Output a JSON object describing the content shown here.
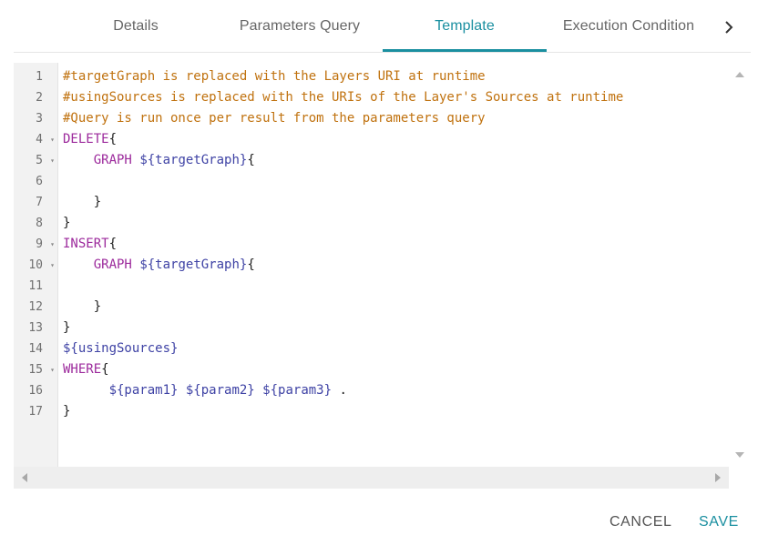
{
  "tabs": [
    {
      "label": "Details",
      "active": false
    },
    {
      "label": "Parameters Query",
      "active": false
    },
    {
      "label": "Template",
      "active": true
    },
    {
      "label": "Execution Condition",
      "active": false
    }
  ],
  "colors": {
    "accent": "#1a8fa0",
    "comment": "#c0720f",
    "keyword": "#9c2a9c",
    "variable": "#3f43a5"
  },
  "icons": {
    "tab_next": "chevron-right-icon",
    "fold": "fold-triangle-icon",
    "scroll_up": "arrow-up-icon",
    "scroll_down": "arrow-down-icon",
    "scroll_left": "arrow-left-icon",
    "scroll_right": "arrow-right-icon"
  },
  "editor": {
    "lines": [
      {
        "number": "1",
        "foldable": false,
        "tokens": [
          {
            "text": "#targetGraph is replaced with the Layers URI at runtime",
            "kind": "comment"
          }
        ]
      },
      {
        "number": "2",
        "foldable": false,
        "tokens": [
          {
            "text": "#usingSources is replaced with the URIs of the Layer's Sources at runtime",
            "kind": "comment"
          }
        ]
      },
      {
        "number": "3",
        "foldable": false,
        "tokens": [
          {
            "text": "#Query is run once per result from the parameters query",
            "kind": "comment"
          }
        ]
      },
      {
        "number": "4",
        "foldable": true,
        "tokens": [
          {
            "text": "DELETE",
            "kind": "kw"
          },
          {
            "text": "{",
            "kind": "plain"
          }
        ]
      },
      {
        "number": "5",
        "foldable": true,
        "tokens": [
          {
            "text": "    ",
            "kind": "plain"
          },
          {
            "text": "GRAPH",
            "kind": "kw"
          },
          {
            "text": " ",
            "kind": "plain"
          },
          {
            "text": "${targetGraph}",
            "kind": "var"
          },
          {
            "text": "{",
            "kind": "plain"
          }
        ]
      },
      {
        "number": "6",
        "foldable": false,
        "tokens": []
      },
      {
        "number": "7",
        "foldable": false,
        "tokens": [
          {
            "text": "    }",
            "kind": "plain"
          }
        ]
      },
      {
        "number": "8",
        "foldable": false,
        "tokens": [
          {
            "text": "}",
            "kind": "plain"
          }
        ]
      },
      {
        "number": "9",
        "foldable": true,
        "tokens": [
          {
            "text": "INSERT",
            "kind": "kw"
          },
          {
            "text": "{",
            "kind": "plain"
          }
        ]
      },
      {
        "number": "10",
        "foldable": true,
        "tokens": [
          {
            "text": "    ",
            "kind": "plain"
          },
          {
            "text": "GRAPH",
            "kind": "kw"
          },
          {
            "text": " ",
            "kind": "plain"
          },
          {
            "text": "${targetGraph}",
            "kind": "var"
          },
          {
            "text": "{",
            "kind": "plain"
          }
        ]
      },
      {
        "number": "11",
        "foldable": false,
        "tokens": []
      },
      {
        "number": "12",
        "foldable": false,
        "tokens": [
          {
            "text": "    }",
            "kind": "plain"
          }
        ]
      },
      {
        "number": "13",
        "foldable": false,
        "tokens": [
          {
            "text": "}",
            "kind": "plain"
          }
        ]
      },
      {
        "number": "14",
        "foldable": false,
        "tokens": [
          {
            "text": "${usingSources}",
            "kind": "var"
          }
        ]
      },
      {
        "number": "15",
        "foldable": true,
        "tokens": [
          {
            "text": "WHERE",
            "kind": "kw"
          },
          {
            "text": "{",
            "kind": "plain"
          }
        ]
      },
      {
        "number": "16",
        "foldable": false,
        "tokens": [
          {
            "text": "      ",
            "kind": "plain"
          },
          {
            "text": "${param1}",
            "kind": "var"
          },
          {
            "text": " ",
            "kind": "plain"
          },
          {
            "text": "${param2}",
            "kind": "var"
          },
          {
            "text": " ",
            "kind": "plain"
          },
          {
            "text": "${param3}",
            "kind": "var"
          },
          {
            "text": " .",
            "kind": "plain"
          }
        ]
      },
      {
        "number": "17",
        "foldable": false,
        "tokens": [
          {
            "text": "}",
            "kind": "plain"
          }
        ]
      }
    ]
  },
  "footer": {
    "cancel_label": "CANCEL",
    "save_label": "SAVE"
  }
}
